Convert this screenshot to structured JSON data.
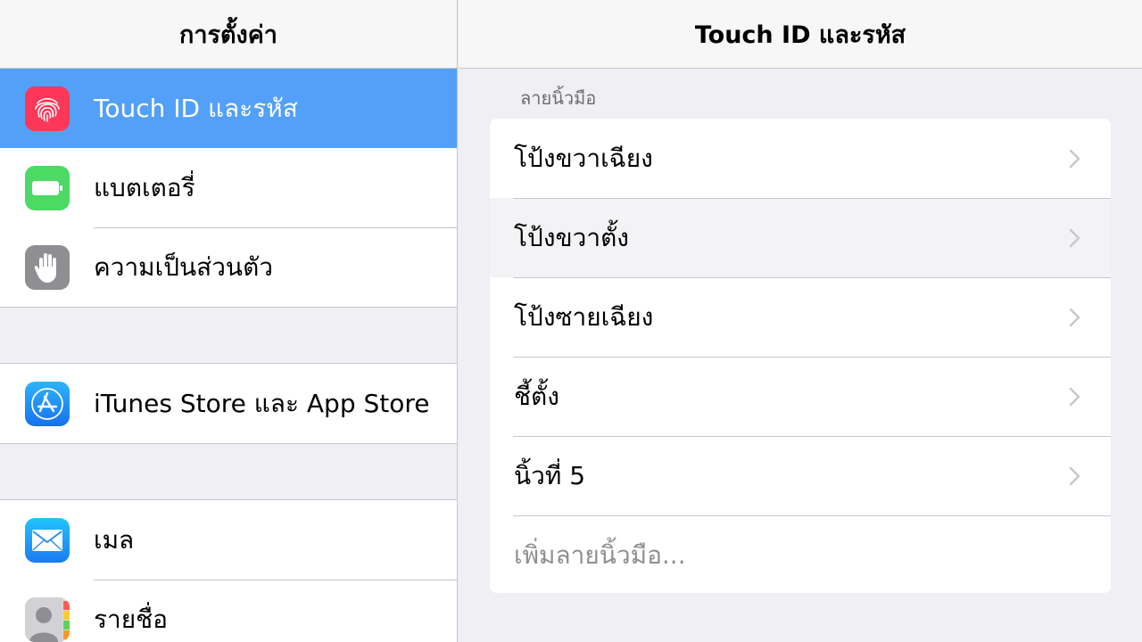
{
  "master": {
    "title": "การตั้งค่า",
    "groups": [
      {
        "items": [
          {
            "label": "Touch ID และรหัส",
            "icon": "fingerprint-icon",
            "icon_color": "#fe3758",
            "selected": true
          },
          {
            "label": "แบตเตอรี่",
            "icon": "battery-icon",
            "icon_color": "#4cd964",
            "selected": false
          },
          {
            "label": "ความเป็นส่วนตัว",
            "icon": "hand-icon",
            "icon_color": "#8e8e93",
            "selected": false
          }
        ]
      },
      {
        "items": [
          {
            "label": "iTunes Store และ App Store",
            "icon": "app-store-icon",
            "icon_color": "#1d8ef5",
            "selected": false
          }
        ]
      },
      {
        "items": [
          {
            "label": "เมล",
            "icon": "mail-icon",
            "icon_color": "#1e90f5",
            "selected": false
          },
          {
            "label": "รายชื่อ",
            "icon": "contacts-icon",
            "icon_color": "#9a9a9f",
            "selected": false
          }
        ]
      }
    ]
  },
  "detail": {
    "title": "Touch ID และรหัส",
    "section_header": "ลายนิ้วมือ",
    "fingerprints": [
      {
        "label": "โป้งขวาเฉียง"
      },
      {
        "label": "โป้งขวาตั้ง"
      },
      {
        "label": "โป้งซายเฉียง"
      },
      {
        "label": "ชี้ตั้ง"
      },
      {
        "label": "นิ้วที่ 5"
      }
    ],
    "add_label": "เพิ่มลายนิ้วมือ..."
  },
  "colors": {
    "selection": "#52a0f8",
    "background": "#efeff4",
    "separator": "#c8c7cc",
    "muted_text": "#8e8e93"
  }
}
